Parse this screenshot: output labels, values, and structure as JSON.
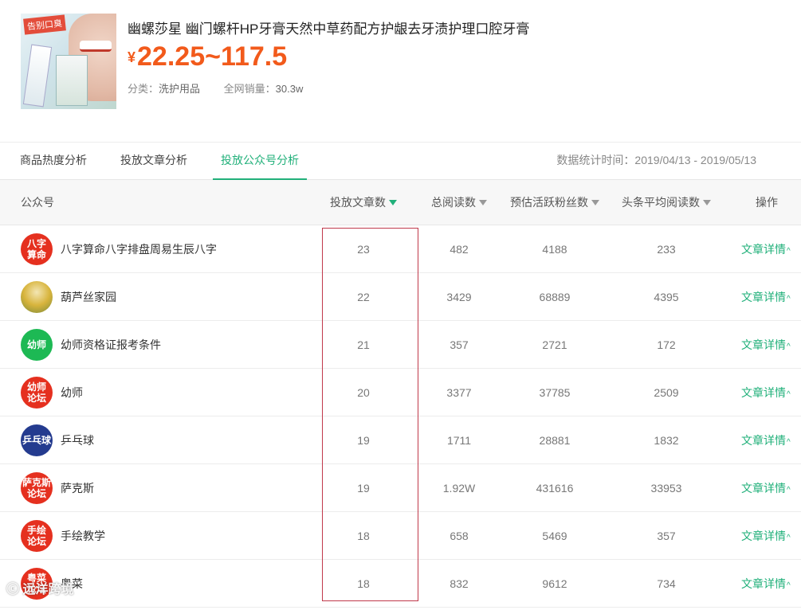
{
  "product": {
    "title": "幽螺莎星 幽门螺杆HP牙膏天然中草药配方护龈去牙渍护理口腔牙膏",
    "currency": "¥",
    "price_range": "22.25~117.5",
    "image_tag": "告别口臭",
    "category_label": "分类：",
    "category_value": "洗护用品",
    "sales_label": "全网销量：",
    "sales_value": "30.3w"
  },
  "tabs": [
    {
      "label": "商品热度分析",
      "active": false
    },
    {
      "label": "投放文章分析",
      "active": false
    },
    {
      "label": "投放公众号分析",
      "active": true
    }
  ],
  "date_range": "数据统计时间：2019/04/13 - 2019/05/13",
  "table": {
    "headers": [
      "公众号",
      "投放文章数",
      "总阅读数",
      "预估活跃粉丝数",
      "头条平均阅读数",
      "操作"
    ],
    "sort_active_column": "投放文章数",
    "action_label": "文章详情",
    "rows": [
      {
        "name": "八字算命八字排盘周易生辰八字",
        "avatar_text": "八字\n算命",
        "avatar_color": "#e5301f",
        "articles": "23",
        "reads": "482",
        "fans": "4188",
        "avg_reads": "233"
      },
      {
        "name": "葫芦丝家园",
        "avatar_text": "",
        "avatar_color": "#c9a42c",
        "articles": "22",
        "reads": "3429",
        "fans": "68889",
        "avg_reads": "4395"
      },
      {
        "name": "幼师资格证报考条件",
        "avatar_text": "幼师",
        "avatar_color": "#1db954",
        "articles": "21",
        "reads": "357",
        "fans": "2721",
        "avg_reads": "172"
      },
      {
        "name": "幼师",
        "avatar_text": "幼师\n论坛",
        "avatar_color": "#e5301f",
        "articles": "20",
        "reads": "3377",
        "fans": "37785",
        "avg_reads": "2509"
      },
      {
        "name": "乒乓球",
        "avatar_text": "乒乓球",
        "avatar_color": "#243b8f",
        "articles": "19",
        "reads": "1711",
        "fans": "28881",
        "avg_reads": "1832"
      },
      {
        "name": "萨克斯",
        "avatar_text": "萨克斯\n论坛",
        "avatar_color": "#e5301f",
        "articles": "19",
        "reads": "1.92W",
        "fans": "431616",
        "avg_reads": "33953"
      },
      {
        "name": "手绘教学",
        "avatar_text": "手绘\n论坛",
        "avatar_color": "#e5301f",
        "articles": "18",
        "reads": "658",
        "fans": "5469",
        "avg_reads": "357"
      },
      {
        "name": "粤菜",
        "avatar_text": "粤菜\n论坛",
        "avatar_color": "#e5301f",
        "articles": "18",
        "reads": "832",
        "fans": "9612",
        "avg_reads": "734"
      }
    ]
  },
  "watermark": "远洋跨境"
}
